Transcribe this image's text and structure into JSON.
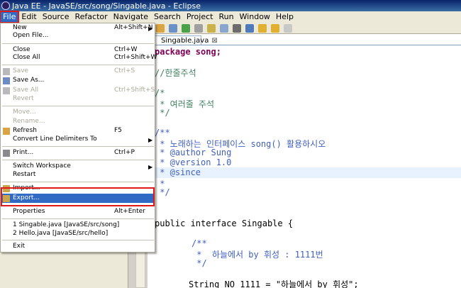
{
  "window": {
    "title": "Java EE - JavaSE/src/song/Singable.java - Eclipse"
  },
  "menubar": [
    "File",
    "Edit",
    "Source",
    "Refactor",
    "Navigate",
    "Search",
    "Project",
    "Run",
    "Window",
    "Help"
  ],
  "file_menu": {
    "new": {
      "label": "New",
      "shortcut": "Alt+Shift+N"
    },
    "open_file": {
      "label": "Open File..."
    },
    "close": {
      "label": "Close",
      "shortcut": "Ctrl+W"
    },
    "close_all": {
      "label": "Close All",
      "shortcut": "Ctrl+Shift+W"
    },
    "save": {
      "label": "Save",
      "shortcut": "Ctrl+S"
    },
    "save_as": {
      "label": "Save As..."
    },
    "save_all": {
      "label": "Save All",
      "shortcut": "Ctrl+Shift+S"
    },
    "revert": {
      "label": "Revert"
    },
    "move": {
      "label": "Move..."
    },
    "rename": {
      "label": "Rename..."
    },
    "refresh": {
      "label": "Refresh",
      "shortcut": "F5"
    },
    "convert": {
      "label": "Convert Line Delimiters To"
    },
    "print": {
      "label": "Print...",
      "shortcut": "Ctrl+P"
    },
    "switch_workspace": {
      "label": "Switch Workspace"
    },
    "restart": {
      "label": "Restart"
    },
    "import": {
      "label": "Import..."
    },
    "export": {
      "label": "Export..."
    },
    "properties": {
      "label": "Properties",
      "shortcut": "Alt+Enter"
    },
    "recent1": {
      "label": "1 Singable.java  [JavaSE/src/song]"
    },
    "recent2": {
      "label": "2 Hello.java  [JavaSE/src/hello]"
    },
    "exit": {
      "label": "Exit"
    }
  },
  "editor": {
    "tab_label": "Singable.java",
    "lines": {
      "package": "package song;",
      "one_line_comment": "//한줄주석",
      "c_open": "/*",
      "c_body": " * 여러줄 주석",
      "c_close": " */",
      "d_open": "/**",
      "d_desc": " * 노래하는 인터페이스 song() 활용하시오",
      "d_author": " * @author Sung",
      "d_version": " * @version 1.0",
      "d_since": " * @since",
      "d_blank": " *",
      "d_close": " */",
      "decl": "public interface Singable {",
      "f_open": "/**",
      "f_desc": " *  하늘에서 by 휘성 : 1111번",
      "f_close": " */",
      "field": "String NO_1111 = \"하늘에서 by 휘성\";"
    }
  }
}
